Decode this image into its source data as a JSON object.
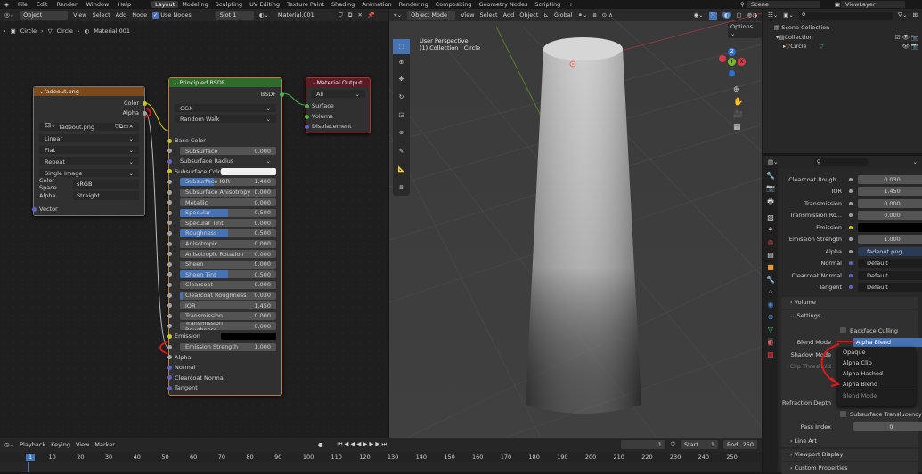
{
  "topbar": {
    "menus": [
      "File",
      "Edit",
      "Render",
      "Window",
      "Help"
    ],
    "workspaces": [
      "Layout",
      "Modeling",
      "Sculpting",
      "UV Editing",
      "Texture Paint",
      "Shading",
      "Animation",
      "Rendering",
      "Compositing",
      "Geometry Nodes",
      "Scripting"
    ],
    "active_workspace": "Layout",
    "scene": "Scene",
    "view_layer": "ViewLayer"
  },
  "node_editor": {
    "header": {
      "mode": "Object",
      "menus": [
        "View",
        "Select",
        "Add",
        "Node"
      ],
      "use_nodes": "Use Nodes",
      "slot": "Slot 1",
      "material": "Material.001"
    },
    "breadcrumb": [
      "Circle",
      "Circle",
      "Material.001"
    ],
    "image_node": {
      "title": "fadeout.png",
      "outputs": [
        "Color",
        "Alpha"
      ],
      "image": "fadeout.png",
      "interpolation": "Linear",
      "projection": "Flat",
      "extension": "Repeat",
      "source": "Single Image",
      "color_space_label": "Color Space",
      "color_space": "sRGB",
      "alpha_label": "Alpha",
      "alpha": "Straight",
      "input": "Vector"
    },
    "bsdf_node": {
      "title": "Principled BSDF",
      "output": "BSDF",
      "distribution": "GGX",
      "subsurface_method": "Random Walk",
      "rows": [
        {
          "label": "Base Color",
          "kind": "socket",
          "color": "#c7c729"
        },
        {
          "label": "Subsurface",
          "value": "0.000",
          "fill": 0
        },
        {
          "label": "Subsurface Radius",
          "kind": "dropdown",
          "color": "#6363c7"
        },
        {
          "label": "Subsurface Color",
          "kind": "color",
          "color": "#c7c729"
        },
        {
          "label": "Subsurface IOR",
          "value": "1.400",
          "fill": 0.35
        },
        {
          "label": "Subsurface Anisotropy",
          "value": "0.000",
          "fill": 0
        },
        {
          "label": "Metallic",
          "value": "0.000",
          "fill": 0
        },
        {
          "label": "Specular",
          "value": "0.500",
          "fill": 0.5
        },
        {
          "label": "Specular Tint",
          "value": "0.000",
          "fill": 0
        },
        {
          "label": "Roughness",
          "value": "0.500",
          "fill": 0.5
        },
        {
          "label": "Anisotropic",
          "value": "0.000",
          "fill": 0
        },
        {
          "label": "Anisotropic Rotation",
          "value": "0.000",
          "fill": 0
        },
        {
          "label": "Sheen",
          "value": "0.000",
          "fill": 0
        },
        {
          "label": "Sheen Tint",
          "value": "0.500",
          "fill": 0.5
        },
        {
          "label": "Clearcoat",
          "value": "0.000",
          "fill": 0
        },
        {
          "label": "Clearcoat Roughness",
          "value": "0.030",
          "fill": 0.03
        },
        {
          "label": "IOR",
          "value": "1.450",
          "fill": 0
        },
        {
          "label": "Transmission",
          "value": "0.000",
          "fill": 0
        },
        {
          "label": "Transmission Roughness",
          "value": "0.000",
          "fill": 0
        },
        {
          "label": "Emission",
          "kind": "black",
          "color": "#c7c729"
        },
        {
          "label": "Emission Strength",
          "value": "1.000",
          "fill": 0
        },
        {
          "label": "Alpha",
          "kind": "socket",
          "color": "#a1a1a1"
        },
        {
          "label": "Normal",
          "kind": "socket",
          "color": "#6363c7"
        },
        {
          "label": "Clearcoat Normal",
          "kind": "socket",
          "color": "#6363c7"
        },
        {
          "label": "Tangent",
          "kind": "socket",
          "color": "#6363c7"
        }
      ]
    },
    "output_node": {
      "title": "Material Output",
      "target": "All",
      "inputs": [
        "Surface",
        "Volume",
        "Displacement"
      ]
    }
  },
  "viewport": {
    "header": {
      "mode": "Object Mode",
      "menus": [
        "View",
        "Select",
        "Add",
        "Object"
      ],
      "orientation": "Global"
    },
    "options": "Options",
    "overlay_title": "User Perspective",
    "overlay_sub": "(1) Collection | Circle",
    "gizmo": {
      "x": "X",
      "y": "Y",
      "z": "Z"
    }
  },
  "outliner": {
    "items": [
      "Scene Collection",
      "Collection",
      "Circle"
    ]
  },
  "properties": {
    "rows": [
      {
        "label": "Clearcoat Rough...",
        "value": "0.030"
      },
      {
        "label": "IOR",
        "value": "1.450"
      },
      {
        "label": "Transmission",
        "value": "0.000"
      },
      {
        "label": "Transmission Ro...",
        "value": "0.000"
      },
      {
        "label": "Emission",
        "value": ""
      },
      {
        "label": "Emission Strength",
        "value": "1.000"
      },
      {
        "label": "Alpha",
        "value": "fadeout.png"
      },
      {
        "label": "Normal",
        "value": "Default"
      },
      {
        "label": "Clearcoat Normal",
        "value": "Default"
      },
      {
        "label": "Tangent",
        "value": "Default"
      }
    ],
    "volume": "Volume",
    "settings": "Settings",
    "backface_culling": "Backface Culling",
    "blend_mode_label": "Blend Mode",
    "blend_mode": "Alpha Blend",
    "shadow_mode_label": "Shadow Mode",
    "clip_threshold_label": "Clip Threshold",
    "blend_options": [
      "Opaque",
      "Alpha Clip",
      "Alpha Hashed",
      "Alpha Blend"
    ],
    "popup_title": "Blend Mode",
    "refraction_depth_label": "Refraction Depth",
    "subsurface_translucency": "Subsurface Translucency",
    "pass_index_label": "Pass Index",
    "pass_index": "0",
    "sections": [
      "Line Art",
      "Viewport Display",
      "Custom Properties"
    ]
  },
  "timeline": {
    "menus": [
      "Playback",
      "Keying",
      "View",
      "Marker"
    ],
    "current_frame": "1",
    "start_label": "Start",
    "start": "1",
    "end_label": "End",
    "end": "250",
    "ticks": [
      "1",
      "10",
      "20",
      "30",
      "40",
      "50",
      "60",
      "70",
      "80",
      "90",
      "100",
      "110",
      "120",
      "130",
      "140",
      "150",
      "160",
      "170",
      "180",
      "190",
      "200",
      "210",
      "220",
      "230",
      "240",
      "250"
    ]
  }
}
